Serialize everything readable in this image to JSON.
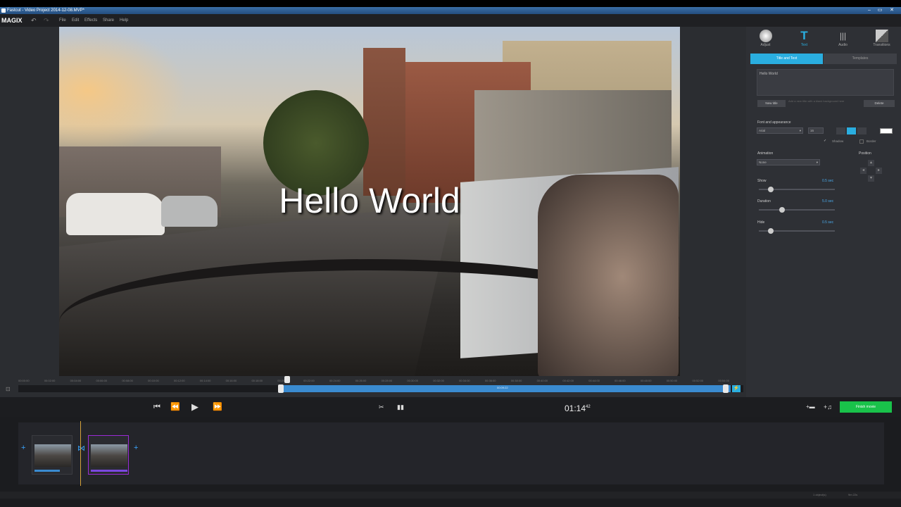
{
  "window": {
    "title": "Fastcut - Video Project 2014-12-08.MVP*",
    "minimize": "–",
    "maximize": "▭",
    "close": "✕"
  },
  "app": {
    "logo": "MAGIX"
  },
  "menu": [
    "File",
    "Edit",
    "Effects",
    "Share",
    "Help"
  ],
  "preview": {
    "title_text": "Hello World"
  },
  "ruler": {
    "ticks": [
      "00:00:00",
      "00:02:00",
      "00:04:00",
      "00:06:00",
      "00:08:00",
      "00:10:00",
      "00:12:00",
      "00:14:00",
      "00:16:00",
      "00:18:00",
      "00:20:00",
      "00:22:00",
      "00:24:00",
      "00:26:00",
      "00:28:00",
      "00:30:00",
      "00:32:00",
      "00:34:00",
      "00:36:00",
      "00:38:00",
      "00:40:00",
      "00:42:00",
      "00:44:00",
      "00:46:00",
      "00:48:00",
      "00:50:00",
      "00:52:00",
      "00:54:00"
    ],
    "range_time": "00:09:22"
  },
  "transport": {
    "timecode": "01:14",
    "timecode_frames": "42",
    "finish_label": "Finish movie"
  },
  "panel": {
    "tabs": [
      {
        "label": "Adjust"
      },
      {
        "label": "Text"
      },
      {
        "label": "Audio"
      },
      {
        "label": "Transitions"
      }
    ],
    "subtabs": {
      "active": "Title and Text",
      "inactive": "Templates"
    },
    "text_value": "Hello World",
    "new_title": "New title",
    "new_title_hint": "Add a new title with a black background here",
    "delete": "Delete",
    "font_heading": "Font and appearance",
    "font_name": "Arial",
    "font_size": "16",
    "shadow_label": "Shadow",
    "border_label": "Border",
    "animation_heading": "Animation",
    "animation_value": "None",
    "position_heading": "Position",
    "show_label": "Show",
    "show_value": "0.5 sec",
    "show_level": 0.12,
    "duration_label": "Duration",
    "duration_value": "5.0 sec",
    "duration_level": 0.27,
    "hide_label": "Hide",
    "hide_value": "0.5 sec",
    "hide_level": 0.12
  },
  "status": {
    "selected": "1 object(s)",
    "duration": "9m 22s"
  },
  "colors": {
    "accent": "#3a8bd0",
    "finish": "#19c24a",
    "active_tab": "#2aaee0"
  }
}
